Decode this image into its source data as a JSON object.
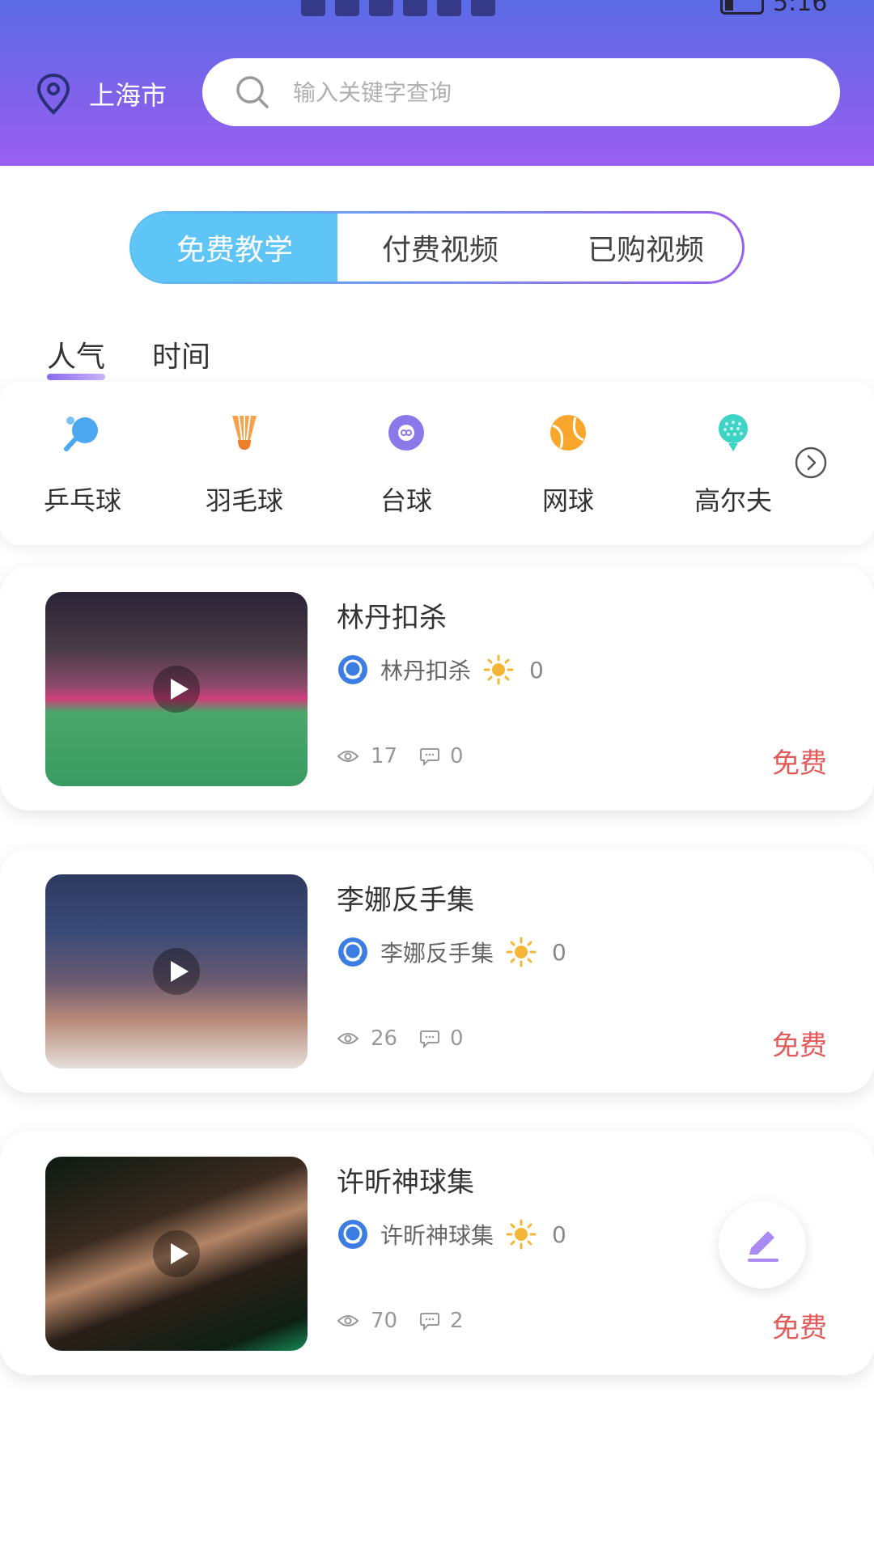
{
  "status_bar": {
    "time": "5:16"
  },
  "header": {
    "location": "上海市",
    "search_placeholder": "输入关键字查询"
  },
  "segments": [
    {
      "label": "免费教学",
      "active": true
    },
    {
      "label": "付费视频",
      "active": false
    },
    {
      "label": "已购视频",
      "active": false
    }
  ],
  "sort_tabs": [
    {
      "label": "人气",
      "active": true
    },
    {
      "label": "时间",
      "active": false
    }
  ],
  "categories": [
    {
      "label": "乒乓球",
      "icon": "ping-pong-icon"
    },
    {
      "label": "羽毛球",
      "icon": "shuttlecock-icon"
    },
    {
      "label": "台球",
      "icon": "billiards-icon"
    },
    {
      "label": "网球",
      "icon": "tennis-ball-icon"
    },
    {
      "label": "高尔夫",
      "icon": "golf-icon"
    }
  ],
  "videos": [
    {
      "title": "林丹扣杀",
      "author": "林丹扣杀",
      "score": "0",
      "views": "17",
      "comments": "0",
      "price": "免费"
    },
    {
      "title": "李娜反手集",
      "author": "李娜反手集",
      "score": "0",
      "views": "26",
      "comments": "0",
      "price": "免费"
    },
    {
      "title": "许昕神球集",
      "author": "许昕神球集",
      "score": "0",
      "views": "70",
      "comments": "2",
      "price": "免费"
    }
  ],
  "colors": {
    "header_gradient": [
      "#5b6ae6",
      "#9a5ff0"
    ],
    "active_segment": "#5fc5f6",
    "price": "#e25b5b"
  }
}
